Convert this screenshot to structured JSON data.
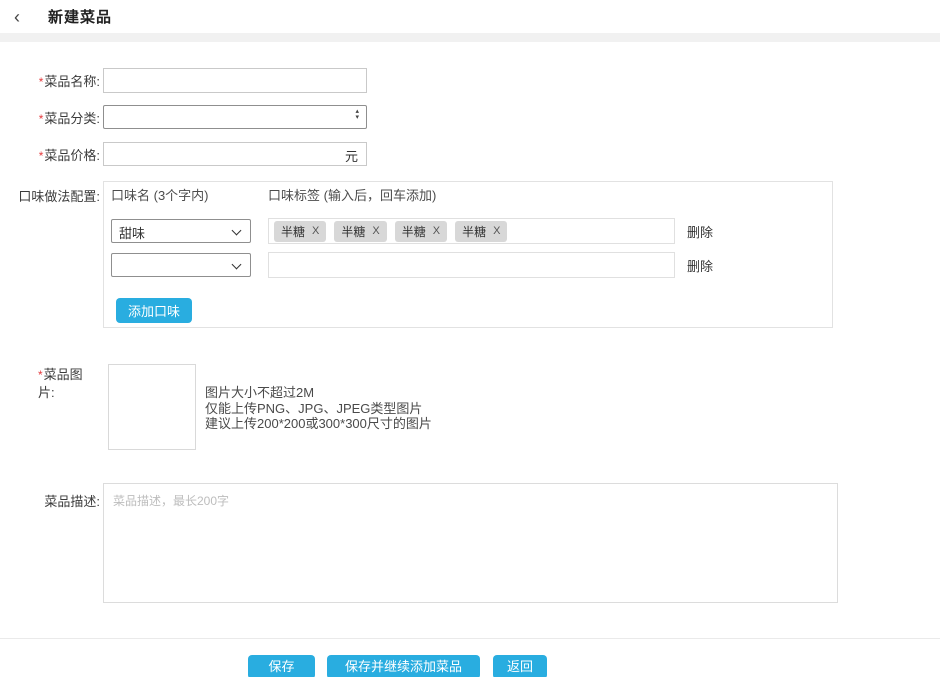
{
  "colors": {
    "primary": "#29ade0",
    "required_mark_color": "#e4393c",
    "tag_bg": "#d8d8d8"
  },
  "header": {
    "back_glyph": "‹",
    "title": "新建菜品"
  },
  "form": {
    "required_mark": "*",
    "name": {
      "label": "菜品名称:",
      "value": ""
    },
    "category": {
      "label": "菜品分类:",
      "value": ""
    },
    "price": {
      "label": "菜品价格:",
      "value": "",
      "suffix": "元"
    },
    "flavor": {
      "label": "口味做法配置:",
      "name_header": "口味名 (3个字内)",
      "tags_header": "口味标签 (输入后，回车添加)",
      "tag_close_glyph": "X",
      "row1": {
        "selected": "甜味",
        "tags": [
          "半糖",
          "半糖",
          "半糖",
          "半糖"
        ],
        "delete_label": "删除"
      },
      "row2": {
        "selected": "",
        "value": "",
        "delete_label": "删除"
      },
      "add_button_label": "添加口味"
    },
    "image": {
      "label": "菜品图片:",
      "hint1": "图片大小不超过2M",
      "hint2": "仅能上传PNG、JPG、JPEG类型图片",
      "hint3": "建议上传200*200或300*300尺寸的图片"
    },
    "description": {
      "label": "菜品描述:",
      "placeholder": "菜品描述，最长200字",
      "value": ""
    }
  },
  "footer": {
    "save_label": "保存",
    "save_continue_label": "保存并继续添加菜品",
    "back_label": "返回"
  }
}
